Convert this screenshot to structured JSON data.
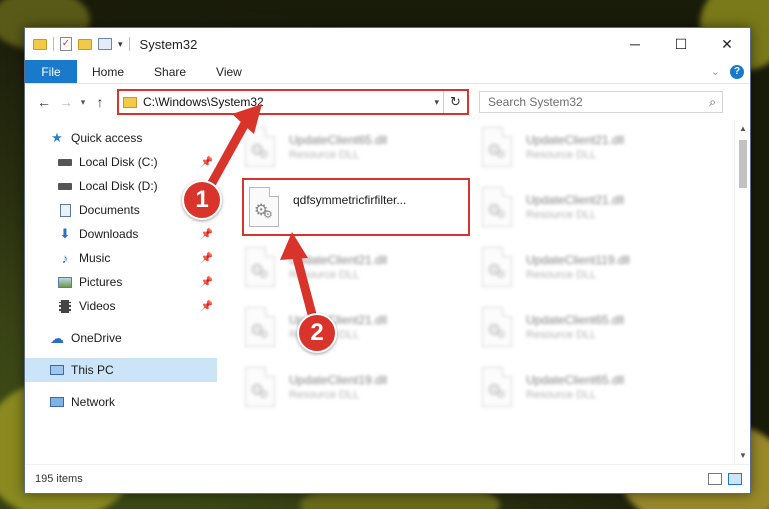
{
  "window": {
    "title": "System32"
  },
  "ribbon": {
    "file": "File",
    "tabs": [
      "Home",
      "Share",
      "View"
    ],
    "help": "?"
  },
  "address": {
    "path": "C:\\Windows\\System32"
  },
  "search": {
    "placeholder": "Search System32"
  },
  "nav": {
    "quick_access": "Quick access",
    "items": [
      {
        "label": "Local Disk (C:)",
        "icon": "drive-icon"
      },
      {
        "label": "Local Disk (D:)",
        "icon": "drive-icon"
      },
      {
        "label": "Documents",
        "icon": "documents-icon"
      },
      {
        "label": "Downloads",
        "icon": "downloads-icon"
      },
      {
        "label": "Music",
        "icon": "music-icon"
      },
      {
        "label": "Pictures",
        "icon": "pictures-icon"
      },
      {
        "label": "Videos",
        "icon": "videos-icon"
      }
    ],
    "onedrive": "OneDrive",
    "this_pc": "This PC",
    "network": "Network"
  },
  "files": {
    "highlighted": {
      "name": "qdfsymmetricfirfilter...",
      "type": ""
    },
    "blurred": [
      {
        "name": "UpdateClient65.dll",
        "type": "Resource DLL"
      },
      {
        "name": "UpdateClient21.dll",
        "type": "Resource DLL"
      },
      {
        "name": "UpdateClient21.dll",
        "type": "Resource DLL"
      },
      {
        "name": "UpdateClient21.dll",
        "type": "Resource DLL"
      },
      {
        "name": "UpdateClient119.dll",
        "type": "Resource DLL"
      },
      {
        "name": "UpdateClient21.dll",
        "type": "Resource DLL"
      },
      {
        "name": "UpdateClient65.dll",
        "type": "Resource DLL"
      },
      {
        "name": "UpdateClient19.dll",
        "type": "Resource DLL"
      },
      {
        "name": "UpdateClient65.dll",
        "type": "Resource DLL"
      }
    ]
  },
  "status": {
    "count": "195 items"
  },
  "annotations": {
    "step1": "1",
    "step2": "2",
    "color": "#d9342b"
  }
}
